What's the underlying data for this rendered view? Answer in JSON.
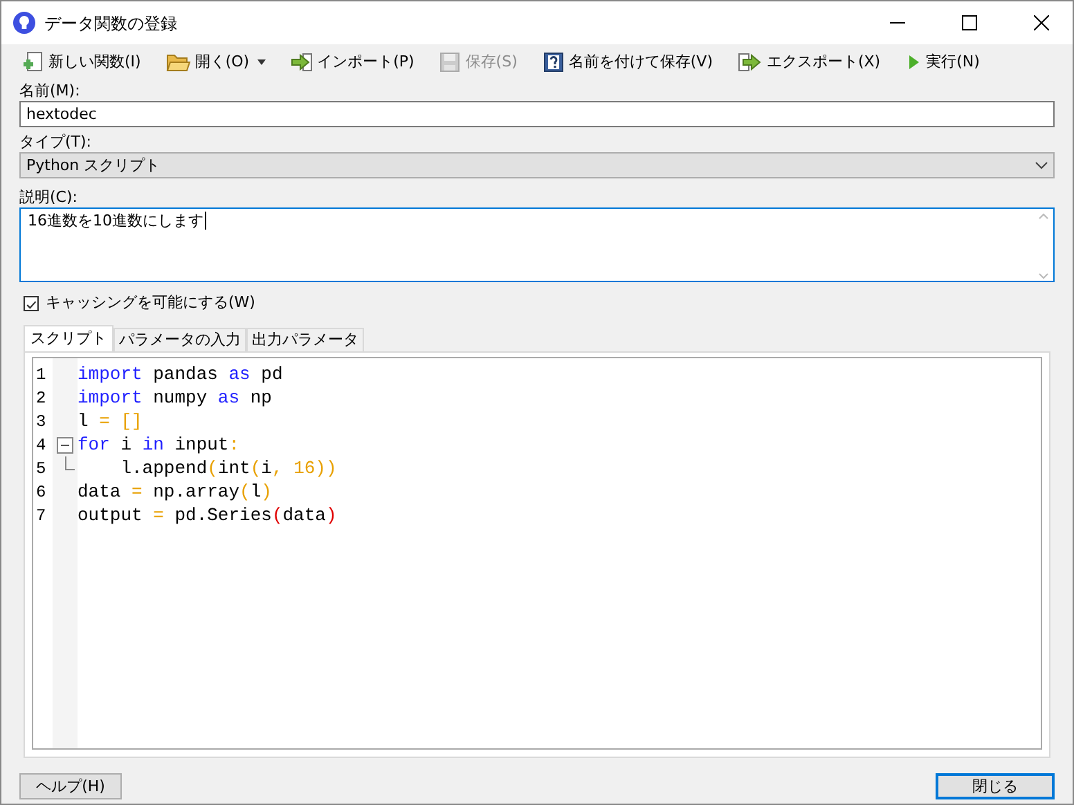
{
  "window": {
    "title": "データ関数の登録"
  },
  "toolbar": [
    {
      "kind": "new",
      "label": "新しい関数(I)",
      "disabled": false,
      "dropdown": false
    },
    {
      "kind": "open",
      "label": "開く(O)",
      "disabled": false,
      "dropdown": true
    },
    {
      "kind": "import",
      "label": "インポート(P)",
      "disabled": false,
      "dropdown": false
    },
    {
      "kind": "save",
      "label": "保存(S)",
      "disabled": true,
      "dropdown": false
    },
    {
      "kind": "saveas",
      "label": "名前を付けて保存(V)",
      "disabled": false,
      "dropdown": false
    },
    {
      "kind": "export",
      "label": "エクスポート(X)",
      "disabled": false,
      "dropdown": false
    },
    {
      "kind": "run",
      "label": "実行(N)",
      "disabled": false,
      "dropdown": false
    }
  ],
  "name": {
    "label": "名前(M):",
    "value": "hextodec"
  },
  "type": {
    "label": "タイプ(T):",
    "value": "Python スクリプト"
  },
  "description": {
    "label": "説明(C):",
    "value": "16進数を10進数にします",
    "focused": true
  },
  "caching": {
    "label": "キャッシングを可能にする(W)",
    "checked": true
  },
  "tabs": [
    {
      "label": "スクリプト",
      "selected": true
    },
    {
      "label": "パラメータの入力",
      "selected": false
    },
    {
      "label": "出力パラメータ",
      "selected": false
    }
  ],
  "code": [
    {
      "number": "1",
      "collapsible": false,
      "fold_end": false,
      "tokens": [
        {
          "kind": "kw",
          "text": "import"
        },
        {
          "kind": "plain",
          "text": " pandas "
        },
        {
          "kind": "kw",
          "text": "as"
        },
        {
          "kind": "plain",
          "text": " pd"
        }
      ]
    },
    {
      "number": "2",
      "collapsible": false,
      "fold_end": false,
      "tokens": [
        {
          "kind": "kw",
          "text": "import"
        },
        {
          "kind": "plain",
          "text": " numpy "
        },
        {
          "kind": "kw",
          "text": "as"
        },
        {
          "kind": "plain",
          "text": " np"
        }
      ]
    },
    {
      "number": "3",
      "collapsible": false,
      "fold_end": false,
      "tokens": [
        {
          "kind": "plain",
          "text": "l "
        },
        {
          "kind": "op",
          "text": "= []"
        }
      ]
    },
    {
      "number": "4",
      "collapsible": true,
      "fold_end": false,
      "tokens": [
        {
          "kind": "kw",
          "text": "for"
        },
        {
          "kind": "plain",
          "text": " i "
        },
        {
          "kind": "kw",
          "text": "in"
        },
        {
          "kind": "plain",
          "text": " input"
        },
        {
          "kind": "op",
          "text": ":"
        }
      ]
    },
    {
      "number": "5",
      "collapsible": false,
      "fold_end": true,
      "tokens": [
        {
          "kind": "plain",
          "text": "    l.append"
        },
        {
          "kind": "op",
          "text": "("
        },
        {
          "kind": "plain",
          "text": "int"
        },
        {
          "kind": "op",
          "text": "("
        },
        {
          "kind": "plain",
          "text": "i"
        },
        {
          "kind": "op",
          "text": ", 16))"
        }
      ]
    },
    {
      "number": "6",
      "collapsible": false,
      "fold_end": false,
      "tokens": [
        {
          "kind": "plain",
          "text": "data "
        },
        {
          "kind": "op",
          "text": "="
        },
        {
          "kind": "plain",
          "text": " np.array"
        },
        {
          "kind": "op",
          "text": "("
        },
        {
          "kind": "plain",
          "text": "l"
        },
        {
          "kind": "op",
          "text": ")"
        }
      ]
    },
    {
      "number": "7",
      "collapsible": false,
      "fold_end": false,
      "tokens": [
        {
          "kind": "plain",
          "text": "output "
        },
        {
          "kind": "op",
          "text": "="
        },
        {
          "kind": "plain",
          "text": " pd.Series"
        },
        {
          "kind": "match",
          "text": "("
        },
        {
          "kind": "plain",
          "text": "data"
        },
        {
          "kind": "match",
          "text": ")"
        }
      ]
    }
  ],
  "buttons": [
    {
      "label": "ヘルプ(H)",
      "default": false
    },
    {
      "label": "閉じる",
      "default": true
    }
  ]
}
